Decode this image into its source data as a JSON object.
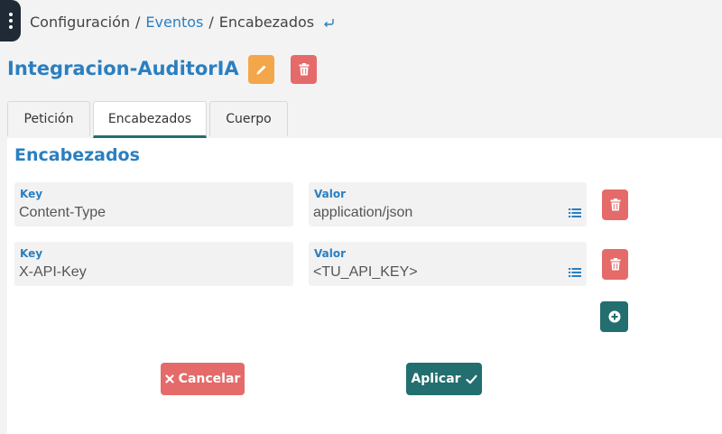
{
  "breadcrumb": {
    "root": "Configuración",
    "section": "Eventos",
    "current": "Encabezados",
    "separator": "/"
  },
  "page": {
    "title": "Integracion-AuditorIA"
  },
  "tabs": [
    {
      "label": "Petición",
      "active": false
    },
    {
      "label": "Encabezados",
      "active": true
    },
    {
      "label": "Cuerpo",
      "active": false
    }
  ],
  "section": {
    "title": "Encabezados"
  },
  "headers": [
    {
      "key_label": "Key",
      "key": "Content-Type",
      "value_label": "Valor",
      "value": "application/json"
    },
    {
      "key_label": "Key",
      "key": "X-API-Key",
      "value_label": "Valor",
      "value": "<TU_API_KEY>"
    }
  ],
  "actions": {
    "cancel_label": "Cancelar",
    "apply_label": "Aplicar"
  },
  "colors": {
    "primary_blue": "#2a7fc0",
    "teal": "#236e6e",
    "danger": "#e56a6a",
    "warning": "#f3a64a",
    "sidebar": "#1f2a36"
  },
  "icons": {
    "menu": "vertical-dots-icon",
    "back": "return-arrow-icon",
    "edit": "pencil-icon",
    "delete": "trash-icon",
    "list": "list-icon",
    "add": "plus-circle-icon",
    "cancel": "x-icon",
    "apply": "check-icon"
  }
}
